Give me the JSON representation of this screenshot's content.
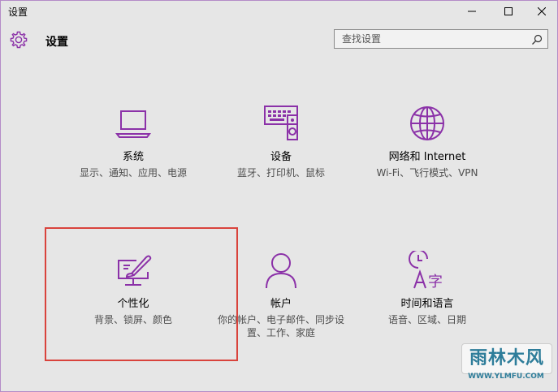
{
  "window": {
    "title": "设置"
  },
  "titlebar": {
    "min_icon": "minimize-icon",
    "max_icon": "maximize-icon",
    "close_icon": "close-icon"
  },
  "header": {
    "title": "设置",
    "icon": "gear-icon"
  },
  "search": {
    "placeholder": "查找设置",
    "icon": "search-icon"
  },
  "accent_color": "#8b31a8",
  "categories": [
    {
      "name": "系统",
      "desc": "显示、通知、应用、电源",
      "icon": "laptop-icon"
    },
    {
      "name": "设备",
      "desc": "蓝牙、打印机、鼠标",
      "icon": "devices-icon"
    },
    {
      "name": "网络和 Internet",
      "desc": "Wi-Fi、飞行模式、VPN",
      "icon": "globe-icon"
    },
    {
      "name": "个性化",
      "desc": "背景、锁屏、颜色",
      "icon": "personalization-icon"
    },
    {
      "name": "帐户",
      "desc": "你的帐户、电子邮件、同步设置、工作、家庭",
      "icon": "person-icon"
    },
    {
      "name": "时间和语言",
      "desc": "语音、区域、日期",
      "icon": "time-language-icon"
    }
  ],
  "watermark": {
    "text": "雨林木风",
    "url": "WWW.YLMFU.COM"
  }
}
